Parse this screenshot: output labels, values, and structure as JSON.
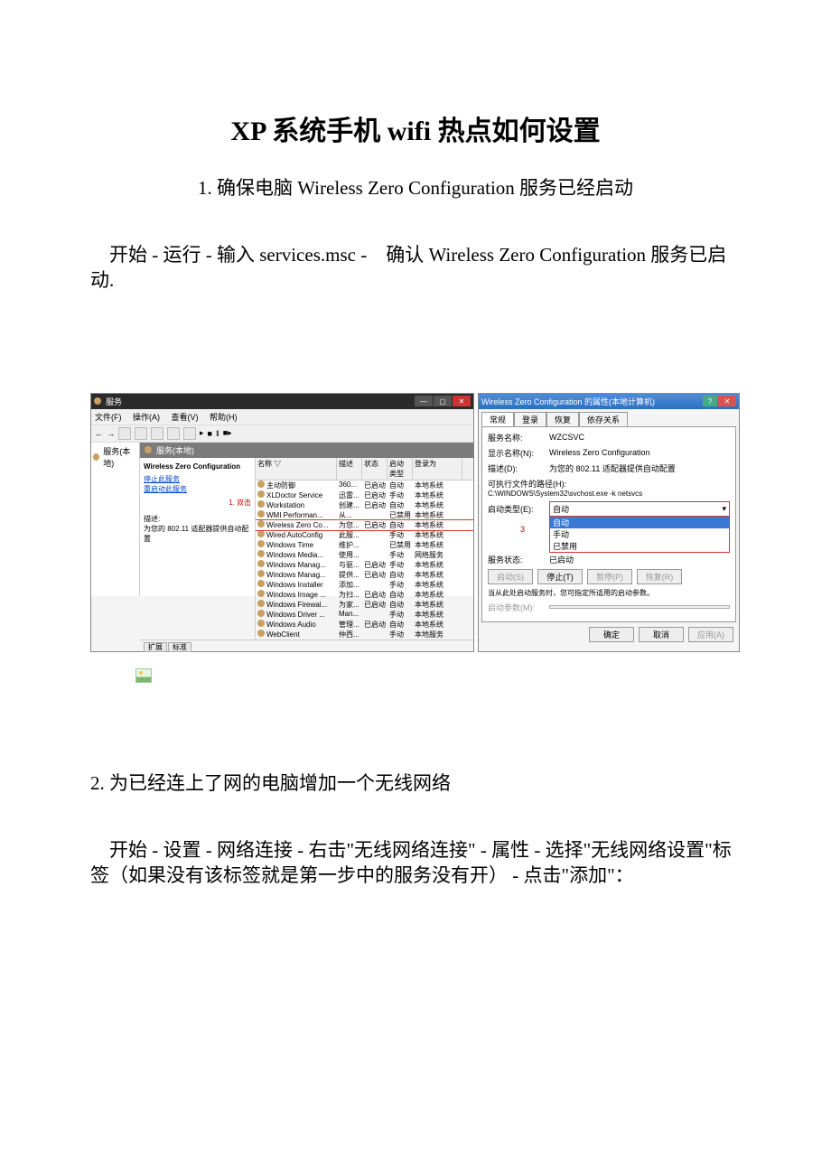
{
  "title": "XP 系统手机 wifi 热点如何设置",
  "step1_title": "1. 确保电脑 Wireless Zero Configuration 服务已经启动",
  "step1_text": "　开始 - 运行 - 输入 services.msc -　确认 Wireless Zero Configuration 服务已启动.",
  "services_window": {
    "title": "服务",
    "menu": {
      "file": "文件(F)",
      "action": "操作(A)",
      "view": "查看(V)",
      "help": "帮助(H)"
    },
    "tree_item": "服务(本地)",
    "list_header": "服务(本地)",
    "detail_name": "Wireless Zero Configuration",
    "link_stop": "停止此服务",
    "link_restart": "重启动此服务",
    "red_label": "1. 双击",
    "desc_label": "描述:",
    "desc_text": "为您的 802.11 适配器提供自动配置",
    "columns": {
      "name": "名称",
      "desc": "描述",
      "status": "状态",
      "type": "启动类型",
      "logon": "登录为"
    },
    "rows": [
      {
        "name": "主动防御",
        "desc": "360...",
        "status": "已启动",
        "type": "自动",
        "logon": "本地系统"
      },
      {
        "name": "XLDoctor Service",
        "desc": "迅雷...",
        "status": "已启动",
        "type": "手动",
        "logon": "本地系统"
      },
      {
        "name": "Workstation",
        "desc": "创建...",
        "status": "已启动",
        "type": "自动",
        "logon": "本地系统"
      },
      {
        "name": "WMI Performan...",
        "desc": "从...",
        "status": "",
        "type": "已禁用",
        "logon": "本地系统"
      },
      {
        "name": "Wireless Zero Co...",
        "desc": "为您...",
        "status": "已启动",
        "type": "自动",
        "logon": "本地系统",
        "hl": "red"
      },
      {
        "name": "Wired AutoConfig",
        "desc": "此服...",
        "status": "",
        "type": "手动",
        "logon": "本地系统"
      },
      {
        "name": "Windows Time",
        "desc": "维护...",
        "status": "",
        "type": "已禁用",
        "logon": "本地系统"
      },
      {
        "name": "Windows Media...",
        "desc": "使用...",
        "status": "",
        "type": "手动",
        "logon": "网络服务"
      },
      {
        "name": "Windows Manag...",
        "desc": "与驱...",
        "status": "已启动",
        "type": "手动",
        "logon": "本地系统"
      },
      {
        "name": "Windows Manag...",
        "desc": "提供...",
        "status": "已启动",
        "type": "自动",
        "logon": "本地系统"
      },
      {
        "name": "Windows Installer",
        "desc": "添加...",
        "status": "",
        "type": "手动",
        "logon": "本地系统"
      },
      {
        "name": "Windows Image ...",
        "desc": "为扫...",
        "status": "已启动",
        "type": "自动",
        "logon": "本地系统"
      },
      {
        "name": "Windows Firewal...",
        "desc": "为家...",
        "status": "已启动",
        "type": "自动",
        "logon": "本地系统"
      },
      {
        "name": "Windows Driver ...",
        "desc": "Man...",
        "status": "",
        "type": "手动",
        "logon": "本地系统"
      },
      {
        "name": "Windows Audio",
        "desc": "管理...",
        "status": "已启动",
        "type": "自动",
        "logon": "本地系统"
      },
      {
        "name": "WebClient",
        "desc": "仲西...",
        "status": "",
        "type": "手动",
        "logon": "本地服务"
      }
    ],
    "tabs": {
      "ext": "扩展",
      "std": "标准"
    }
  },
  "properties_window": {
    "title": "Wireless Zero Configuration 的属性(本地计算机)",
    "tabs": {
      "general": "常规",
      "logon": "登录",
      "recovery": "恢复",
      "deps": "依存关系"
    },
    "label_svcname": "服务名称:",
    "val_svcname": "WZCSVC",
    "label_dispname": "显示名称(N):",
    "val_dispname": "Wireless Zero Configuration",
    "label_desc": "描述(D):",
    "val_desc": "为您的 802.11 适配器提供自动配置",
    "label_path": "可执行文件的路径(H):",
    "val_path": "C:\\WINDOWS\\System32\\svchost.exe -k netsvcs",
    "label_starttype": "启动类型(E):",
    "val_starttype": "自动",
    "red_num": "3",
    "combo_opts": {
      "auto": "自动",
      "manual": "手动",
      "disabled": "已禁用"
    },
    "label_status": "服务状态:",
    "val_status": "已启动",
    "btn_start": "启动(S)",
    "btn_stop": "停止(T)",
    "btn_pause": "暂停(P)",
    "btn_resume": "恢复(R)",
    "hint": "当从此处启动服务时，您可指定所适用的启动参数。",
    "label_params": "启动参数(M):",
    "btn_ok": "确定",
    "btn_cancel": "取消",
    "btn_apply": "应用(A)"
  },
  "step2_title": "2. 为已经连上了网的电脑增加一个无线网络",
  "step2_text": "　开始 - 设置 - 网络连接 - 右击\"无线网络连接\" - 属性 - 选择\"无线网络设置\"标签（如果没有该标签就是第一步中的服务没有开） - 点击\"添加\"："
}
